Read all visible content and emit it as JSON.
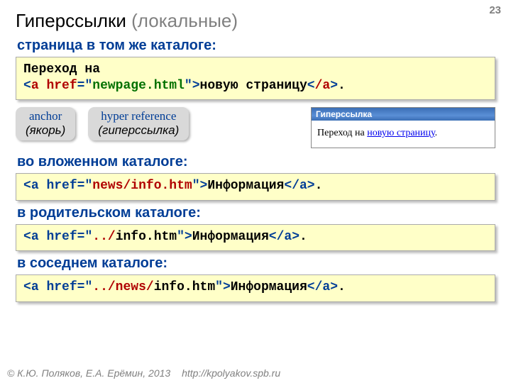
{
  "page_number": "23",
  "title": {
    "main": "Гиперссылки ",
    "gray": "(локальные)"
  },
  "sections": {
    "s1": "страница в том же каталоге:",
    "s2": "во вложенном каталоге:",
    "s3": "в родительском каталоге:",
    "s4": "в соседнем каталоге:"
  },
  "code": {
    "c1_pre": "Переход на",
    "lt": "<",
    "gt": ">",
    "a": "a",
    "slash_a": "/a",
    "href": "href",
    "eq": "=",
    "q": "\"",
    "dot": ".",
    "c1_link": "newpage.html",
    "c1_text": "новую страницу",
    "c2_link": "news/info.htm",
    "c2_text": "Информация",
    "c3_prefix": "../",
    "c3_link": "info.htm",
    "c3_text": "Информация",
    "c4_prefix": "../news/",
    "c4_link": "info.htm",
    "c4_text": "Информация"
  },
  "pills": {
    "anchor_en": "anchor",
    "anchor_ru": "(якорь)",
    "href_en": "hyper reference",
    "href_ru": "(гиперссылка)"
  },
  "browser": {
    "title": "Гиперссылка",
    "text_pre": "Переход на ",
    "link": "новую страницу",
    "text_post": "."
  },
  "footer": {
    "copyright": "© К.Ю. Поляков, Е.А. Ерёмин, 2013",
    "url": "http://kpolyakov.spb.ru"
  }
}
